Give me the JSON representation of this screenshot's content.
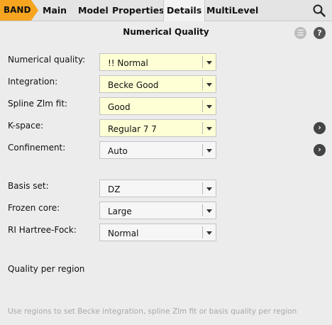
{
  "tabs": [
    {
      "label": "BAND"
    },
    {
      "label": "Main"
    },
    {
      "label": "Model"
    },
    {
      "label": "Properties"
    },
    {
      "label": "Details"
    },
    {
      "label": "MultiLevel"
    }
  ],
  "active_tab": "Details",
  "panel": {
    "title": "Numerical Quality",
    "menu_icon": "☰",
    "help_icon": "?"
  },
  "fields": [
    {
      "label": "Numerical quality:",
      "value": "!! Normal"
    },
    {
      "label": "Integration:",
      "value": "Becke Good"
    },
    {
      "label": "Spline Zlm fit:",
      "value": "Good"
    },
    {
      "label": "K-space:",
      "value": "Regular 7 7"
    },
    {
      "label": "Confinement:",
      "value": "Auto"
    },
    {
      "label": "Basis set:",
      "value": "DZ"
    },
    {
      "label": "Frozen core:",
      "value": "Large"
    },
    {
      "label": "RI Hartree-Fock:",
      "value": "Normal"
    }
  ],
  "go_icon": "›",
  "quality_per_region": "Quality per region",
  "hint": "Use regions to set Becke integration, spline Zlm fit or basis quality per region",
  "colors": {
    "accent": "#f5a51f",
    "highlight": "#ffffd5",
    "background": "#ececec"
  }
}
